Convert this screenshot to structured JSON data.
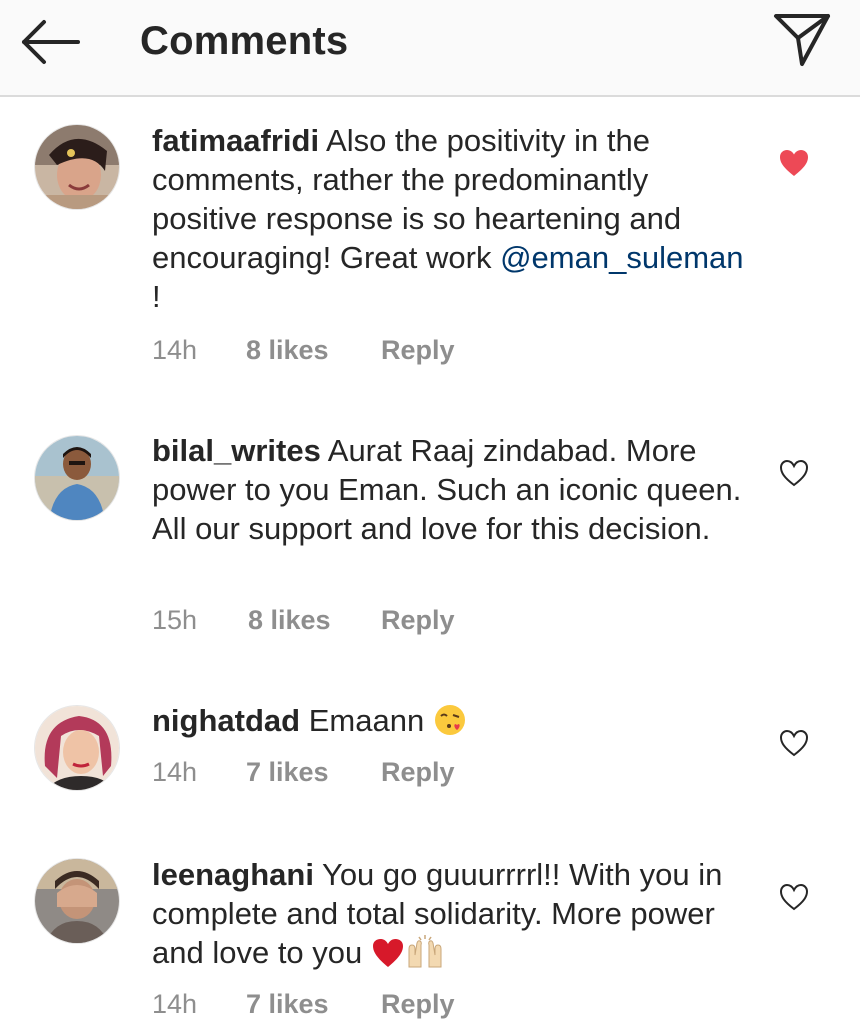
{
  "header": {
    "title": "Comments"
  },
  "colors": {
    "liked_heart": "#ed4956",
    "mention": "#00376b",
    "meta_gray": "#8e8e8e",
    "text": "#262626"
  },
  "comments": [
    {
      "username": "fatimaafridi",
      "text": " Also the positivity in the comments, rather the predominantly positive response is so heartening and encouraging! Great work ",
      "mention": "@eman_suleman",
      "text_after": " !",
      "time": "14h",
      "likes": "8 likes",
      "reply": "Reply",
      "liked": true,
      "heart_icon": "heart-filled-icon"
    },
    {
      "username": "bilal_writes",
      "text": " Aurat Raaj zindabad. More power to you Eman. Such an iconic queen. All our support and love for this decision.",
      "time": "15h",
      "likes": "8 likes",
      "reply": "Reply",
      "liked": false,
      "heart_icon": "heart-outline-icon"
    },
    {
      "username": "nighatdad",
      "text": " Emaann ",
      "emoji": "face-blowing-kiss-emoji",
      "time": "14h",
      "likes": "7 likes",
      "reply": "Reply",
      "liked": false,
      "heart_icon": "heart-outline-icon"
    },
    {
      "username": "leenaghani",
      "text": " You go guuurrrrl!! With you in complete and total solidarity. More power and love to you ",
      "emojis": [
        "red-heart-emoji",
        "raising-hands-emoji"
      ],
      "time": "14h",
      "likes": "7 likes",
      "reply": "Reply",
      "liked": false,
      "heart_icon": "heart-outline-icon"
    }
  ]
}
